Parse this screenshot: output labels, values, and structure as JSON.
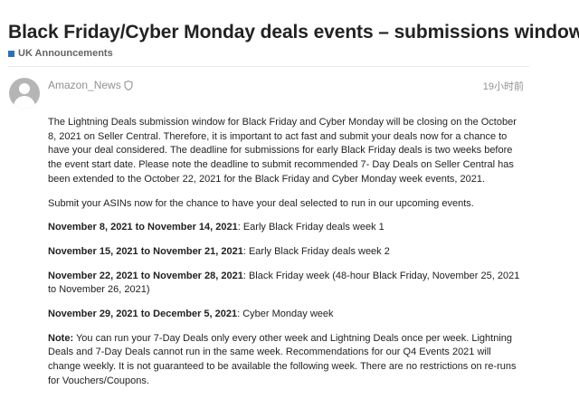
{
  "topic": {
    "title": "Black Friday/Cyber Monday deals events – submissions window cl",
    "category": "UK Announcements",
    "category_color": "#2f6fb5"
  },
  "post": {
    "author": "Amazon_News",
    "author_icon": "shield-icon",
    "date": "19小时前",
    "paragraphs": [
      "The Lightning Deals submission window for Black Friday and Cyber Monday will be closing on the October 8, 2021 on Seller Central. Therefore, it is important to act fast and submit your deals now for a chance to have your deal considered. The deadline for submissions for early Black Friday deals is two weeks before the event start date. Please note the deadline to submit recommended 7- Day Deals on Seller Central has been extended to the October 22, 2021 for the Black Friday and Cyber Monday week events, 2021.",
      "Submit your ASINs now for the chance to have your deal selected to run in our upcoming events."
    ],
    "schedule": [
      {
        "dates": "November 8, 2021 to November 14, 2021",
        "desc": ": Early Black Friday deals week 1"
      },
      {
        "dates": "November 15, 2021 to November 21, 2021",
        "desc": ": Early Black Friday deals week 2"
      },
      {
        "dates": "November 22, 2021 to November 28, 2021",
        "desc": ": Black Friday week (48-hour Black Friday, November 25, 2021 to November 26, 2021)"
      },
      {
        "dates": "November 29, 2021 to December 5, 2021",
        "desc": ": Cyber Monday week"
      }
    ],
    "note_label": "Note:",
    "note_text": " You can run your 7-Day Deals only every other week and Lightning Deals once per week. Lightning Deals and 7-Day Deals cannot run in the same week. Recommendations for our Q4 Events 2021 will change weekly. It is not guaranteed to be available the following week. There are no restrictions on re-runs for Vouchers/Coupons."
  }
}
